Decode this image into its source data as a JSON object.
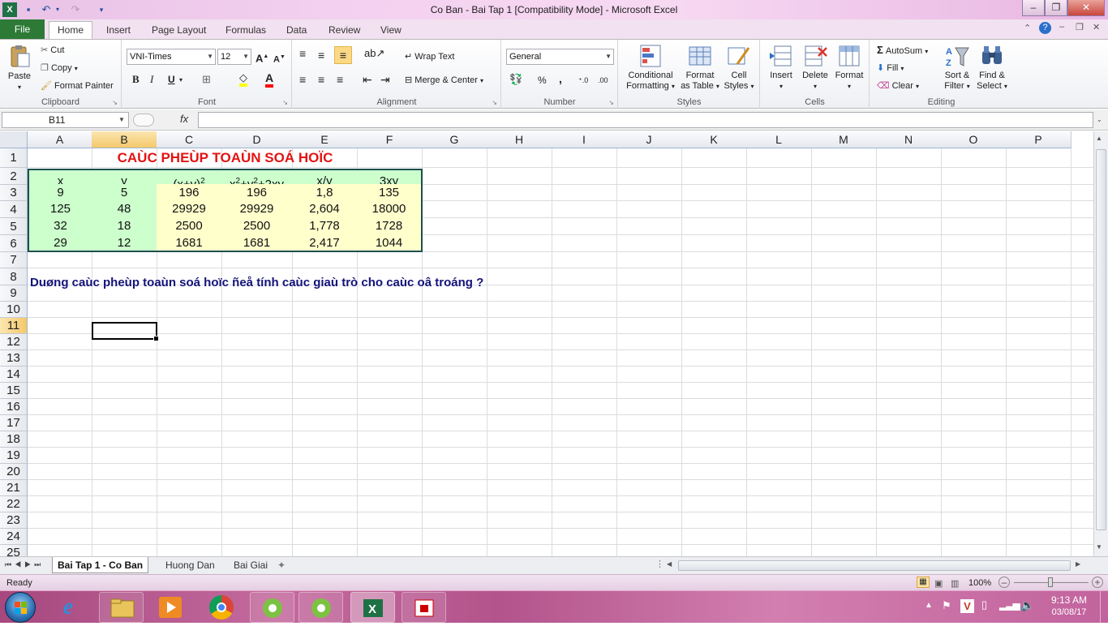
{
  "window": {
    "title": "Co Ban - Bai Tap 1  [Compatibility Mode]  -  Microsoft Excel",
    "minimize": "–",
    "restore": "❐",
    "close": "✕"
  },
  "ribbon_tabs": {
    "file": "File",
    "home": "Home",
    "insert": "Insert",
    "page_layout": "Page Layout",
    "formulas": "Formulas",
    "data": "Data",
    "review": "Review",
    "view": "View"
  },
  "clipboard": {
    "label": "Clipboard",
    "paste": "Paste",
    "cut": "Cut",
    "copy": "Copy",
    "format_painter": "Format Painter"
  },
  "font": {
    "label": "Font",
    "name": "VNI-Times",
    "size": "12",
    "bold": "B",
    "italic": "I",
    "underline": "U"
  },
  "alignment": {
    "label": "Alignment",
    "wrap_text": "Wrap Text",
    "merge_center": "Merge & Center"
  },
  "number": {
    "label": "Number",
    "format": "General",
    "percent": "%",
    "comma": ","
  },
  "styles": {
    "label": "Styles",
    "conditional_1": "Conditional",
    "conditional_2": "Formatting",
    "format_table_1": "Format",
    "format_table_2": "as Table",
    "cell_styles_1": "Cell",
    "cell_styles_2": "Styles"
  },
  "cells_group": {
    "label": "Cells",
    "insert": "Insert",
    "delete": "Delete",
    "format": "Format"
  },
  "editing": {
    "label": "Editing",
    "autosum": "AutoSum",
    "fill": "Fill",
    "clear": "Clear",
    "sort_1": "Sort &",
    "sort_2": "Filter",
    "find_1": "Find &",
    "find_2": "Select"
  },
  "formula_bar": {
    "name_box": "B11",
    "fx": "fx",
    "content": ""
  },
  "columns": [
    "A",
    "B",
    "C",
    "D",
    "E",
    "F",
    "G",
    "H",
    "I",
    "J",
    "K",
    "L",
    "M",
    "N",
    "O",
    "P"
  ],
  "rows": [
    "1",
    "2",
    "3",
    "4",
    "5",
    "6",
    "7",
    "8",
    "9",
    "10",
    "11",
    "12",
    "13",
    "14",
    "15",
    "16",
    "17",
    "18",
    "19",
    "20",
    "21",
    "22",
    "23",
    "24",
    "25"
  ],
  "sheet": {
    "title": "CAÙC PHEÙP TOAÙN SOÁ HOÏC",
    "headers": [
      "x",
      "y",
      "(x+y)",
      "x",
      "+y",
      "+2xy",
      "x/y",
      "3xy"
    ],
    "sup2": "2",
    "data": [
      [
        "9",
        "5",
        "196",
        "196",
        "1,8",
        "135"
      ],
      [
        "125",
        "48",
        "29929",
        "29929",
        "2,604",
        "18000"
      ],
      [
        "32",
        "18",
        "2500",
        "2500",
        "1,778",
        "1728"
      ],
      [
        "29",
        "12",
        "1681",
        "1681",
        "2,417",
        "1044"
      ]
    ],
    "question": "Duøng caùc pheùp toaùn soá hoïc ñeå tính caùc giaù trò cho caùc oâ troáng ?"
  },
  "sheet_tabs": [
    "Bai Tap 1 - Co Ban",
    "Huong Dan",
    "Bai Giai"
  ],
  "status": {
    "ready": "Ready",
    "zoom": "100%"
  },
  "taskbar": {
    "time": "9:13 AM",
    "date": "03/08/17"
  },
  "colors": {
    "title_red": "#e31313",
    "question_navy": "#13137a",
    "cell_green": "#ccffcc",
    "cell_yellow": "#ffffcc",
    "file_tab": "#2c7a35"
  }
}
